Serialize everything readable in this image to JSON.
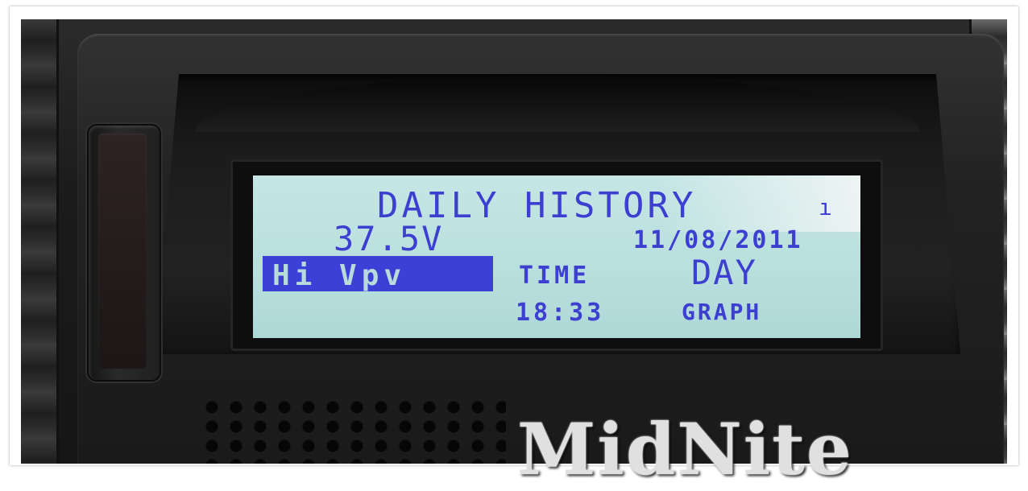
{
  "lcd": {
    "title": "DAILY HISTORY",
    "indicator": "ı",
    "value": "37.5V",
    "date": "11/08/2011",
    "mode": "Hi Vpv",
    "time_label": "TIME",
    "time": "18:33",
    "period": "DAY",
    "view": "GRAPH"
  },
  "device": {
    "brand_logo": "MidNite"
  },
  "colors": {
    "lcd_background": "#bfe2e1",
    "lcd_text": "#3c3fd0",
    "casing": "#1e1e1e"
  }
}
